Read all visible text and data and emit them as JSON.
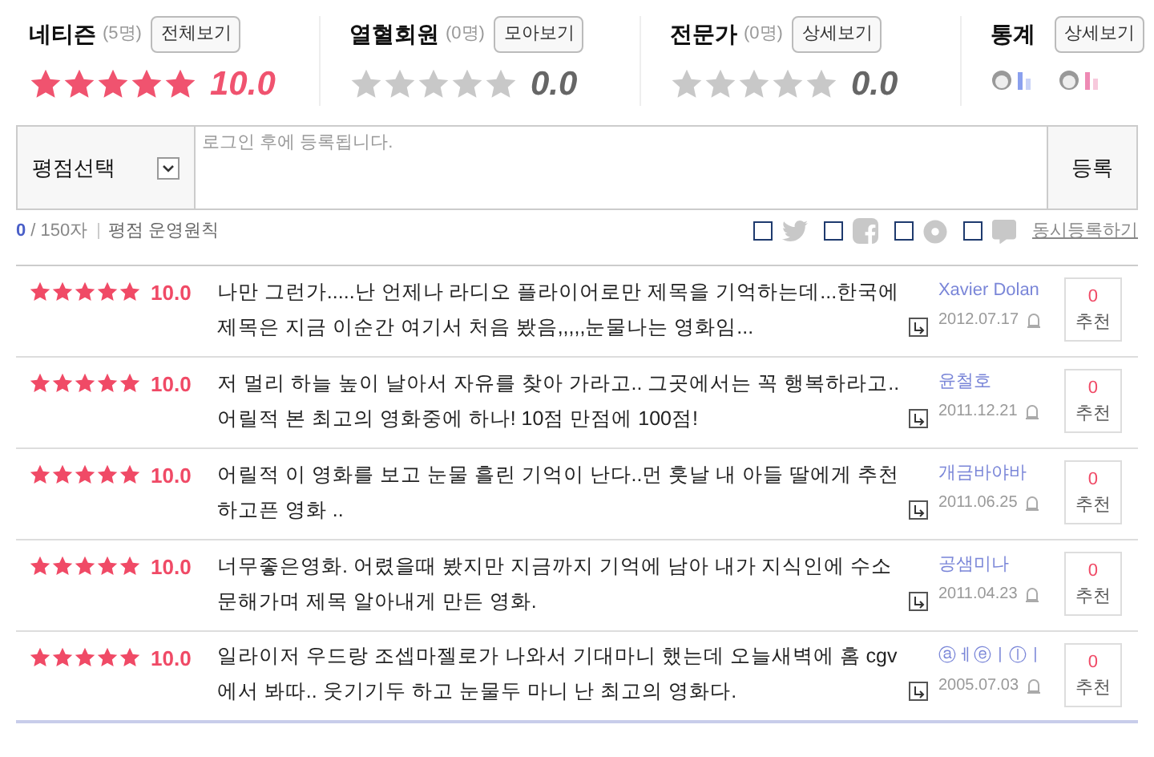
{
  "summary": [
    {
      "label": "네티즌",
      "count": "(5명)",
      "button": "전체보기",
      "stars": 5,
      "score": "10.0"
    },
    {
      "label": "열혈회원",
      "count": "(0명)",
      "button": "모아보기",
      "stars": 0,
      "score": "0.0"
    },
    {
      "label": "전문가",
      "count": "(0명)",
      "button": "상세보기",
      "stars": 0,
      "score": "0.0"
    }
  ],
  "stats": {
    "label": "통계",
    "button": "상세보기"
  },
  "form": {
    "select": "평점선택",
    "placeholder": "로그인 후에 등록됩니다.",
    "submit": "등록"
  },
  "counter": {
    "count": "0",
    "limit": "/ 150자",
    "rules_link": "평점 운영원칙"
  },
  "share": [
    {
      "kind": "bird",
      "checked": false
    },
    {
      "kind": "facebook",
      "checked": false
    },
    {
      "kind": "disc",
      "checked": false
    },
    {
      "kind": "chat",
      "checked": false
    }
  ],
  "share_link": "동시등록하기",
  "reviews": [
    {
      "stars": 5,
      "score": "10.0",
      "text": "나만 그런가.....난 언제나 라디오 플라이어로만 제목을 기억하는데...한국에 제목은 지금 이순간 여기서 처음 봤음,,,,,눈물나는 영화임...",
      "author": "Xavier Dolan",
      "date": "2012.07.17",
      "likes": "0",
      "like_label": "추천"
    },
    {
      "stars": 5,
      "score": "10.0",
      "text": "저 멀리 하늘 높이 날아서 자유를 찾아 가라고.. 그곳에서는 꼭 행복하라고.. 어릴적 본 최고의 영화중에 하나! 10점 만점에 100점!",
      "author": "윤철호",
      "date": "2011.12.21",
      "likes": "0",
      "like_label": "추천"
    },
    {
      "stars": 5,
      "score": "10.0",
      "text": "어릴적 이 영화를 보고 눈물 흘린 기억이 난다..먼 훗날 내 아들 딸에게 추천하고픈 영화 ..",
      "author": "개금바야바",
      "date": "2011.06.25",
      "likes": "0",
      "like_label": "추천"
    },
    {
      "stars": 5,
      "score": "10.0",
      "text": "너무좋은영화. 어렸을때 봤지만 지금까지 기억에 남아 내가 지식인에 수소문해가며 제목 알아내게 만든 영화.",
      "author": "공샘미나",
      "date": "2011.04.23",
      "likes": "0",
      "like_label": "추천"
    },
    {
      "stars": 5,
      "score": "10.0",
      "text": "일라이저 우드랑 조셉마젤로가 나와서 기대마니 했는데 오늘새벽에 홈 cgv에서 봐따.. 웃기기두 하고 눈물두 마니 난 최고의 영화다.",
      "author": "ⓐㅔⓔㅣⓛㅣ",
      "date": "2005.07.03",
      "likes": "0",
      "like_label": "추천"
    }
  ]
}
